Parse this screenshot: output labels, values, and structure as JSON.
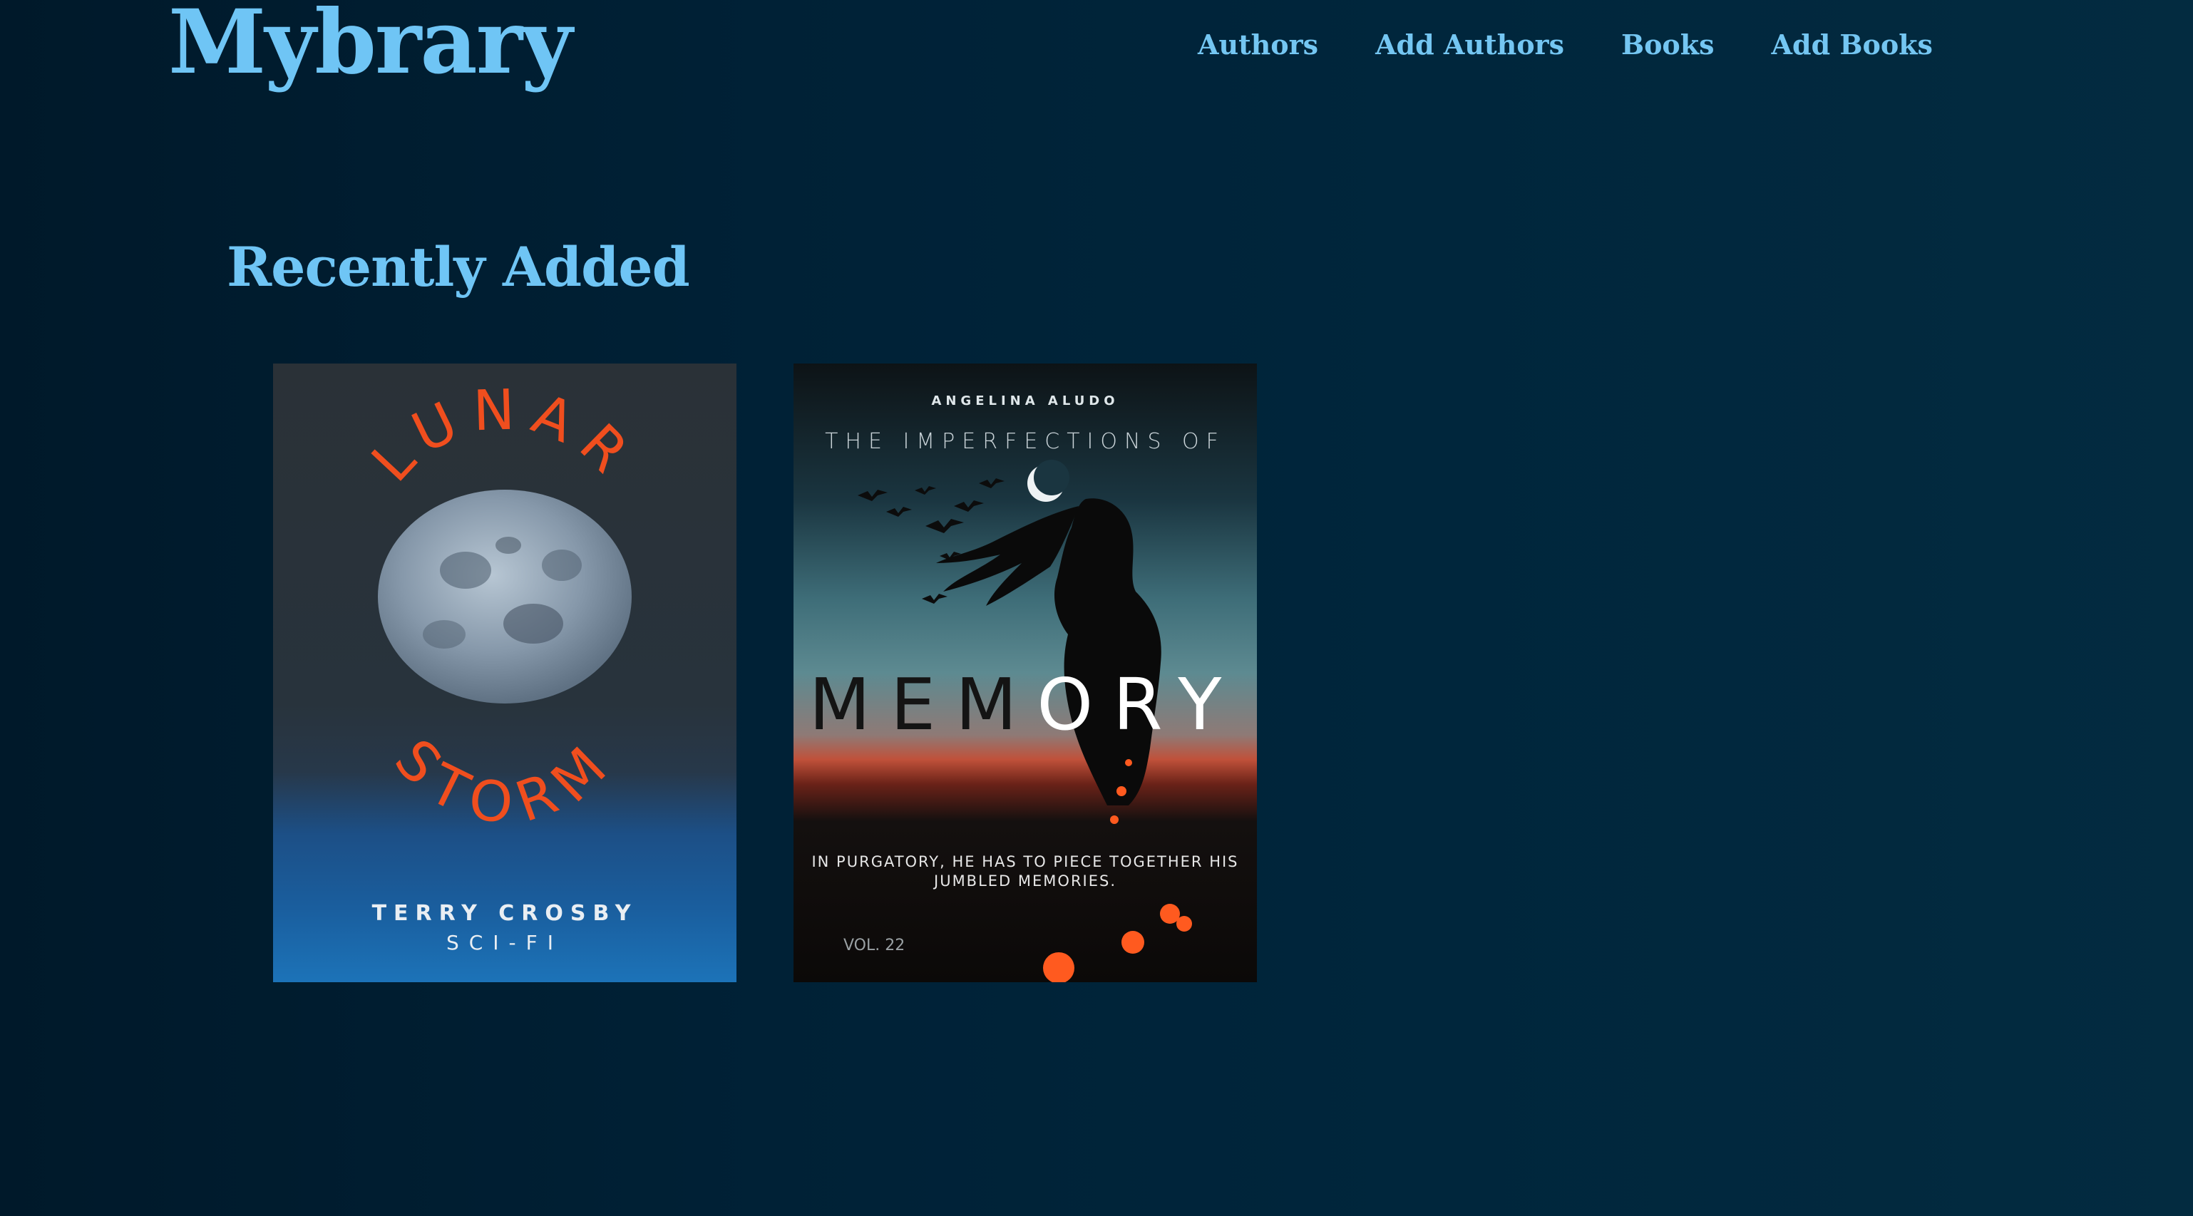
{
  "header": {
    "logo": "Mybrary",
    "nav": [
      {
        "label": "Authors"
      },
      {
        "label": "Add Authors"
      },
      {
        "label": "Books"
      },
      {
        "label": "Add Books"
      }
    ]
  },
  "main": {
    "section_title": "Recently Added",
    "books": [
      {
        "cover_title_top": "LUNAR",
        "cover_title_bottom": "STORM",
        "author": "TERRY CROSBY",
        "genre": "SCI-FI"
      },
      {
        "author": "ANGELINA ALUDO",
        "pre_title": "THE IMPERFECTIONS OF",
        "title_dark": "MEM",
        "title_light": "ORY",
        "tagline": "IN PURGATORY, HE HAS TO PIECE TOGETHER HIS JUMBLED MEMORIES.",
        "volume": "VOL. 22"
      }
    ]
  },
  "colors": {
    "accent": "#6fc5f5",
    "background": "#002136",
    "lunar_title": "#f04e1e"
  }
}
